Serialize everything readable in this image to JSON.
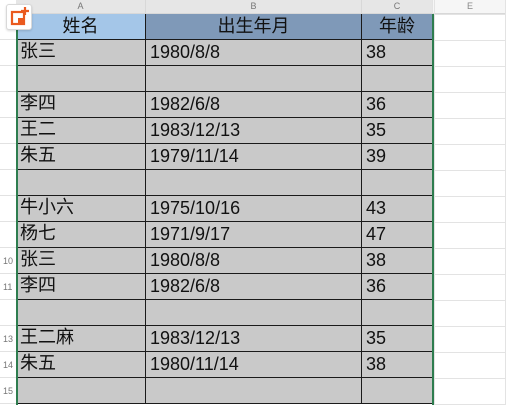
{
  "columns": [
    "A",
    "B",
    "C",
    "",
    "E"
  ],
  "header": [
    "姓名",
    "出生年月",
    "年龄"
  ],
  "row_numbers": [
    "",
    "",
    "",
    "",
    "",
    "",
    "",
    "",
    "",
    "10",
    "11",
    "",
    "13",
    "14",
    "15"
  ],
  "rows": [
    [
      "张三",
      "1980/8/8",
      "38"
    ],
    [
      "",
      "",
      ""
    ],
    [
      "李四",
      "1982/6/8",
      "36"
    ],
    [
      "王二",
      "1983/12/13",
      "35"
    ],
    [
      "朱五",
      "1979/11/14",
      "39"
    ],
    [
      "",
      "",
      ""
    ],
    [
      "牛小六",
      "1975/10/16",
      "43"
    ],
    [
      "杨七",
      "1971/9/17",
      "47"
    ],
    [
      "张三",
      "1980/8/8",
      "38"
    ],
    [
      "李四",
      "1982/6/8",
      "36"
    ],
    [
      "",
      "",
      ""
    ],
    [
      "王二麻",
      "1983/12/13",
      "35"
    ],
    [
      "朱五",
      "1980/11/14",
      "38"
    ],
    [
      "",
      "",
      ""
    ]
  ],
  "colors": {
    "header_name_bg": "#a4c6e8",
    "header_date_bg": "#7f99b8",
    "header_age_bg": "#7f99b8",
    "data_bg": "#c9c9c9",
    "selection_edge": "#2e7d4f",
    "badge_icon": "#ea5a1f"
  },
  "icons": {
    "corner_badge": "add-comment-icon"
  }
}
